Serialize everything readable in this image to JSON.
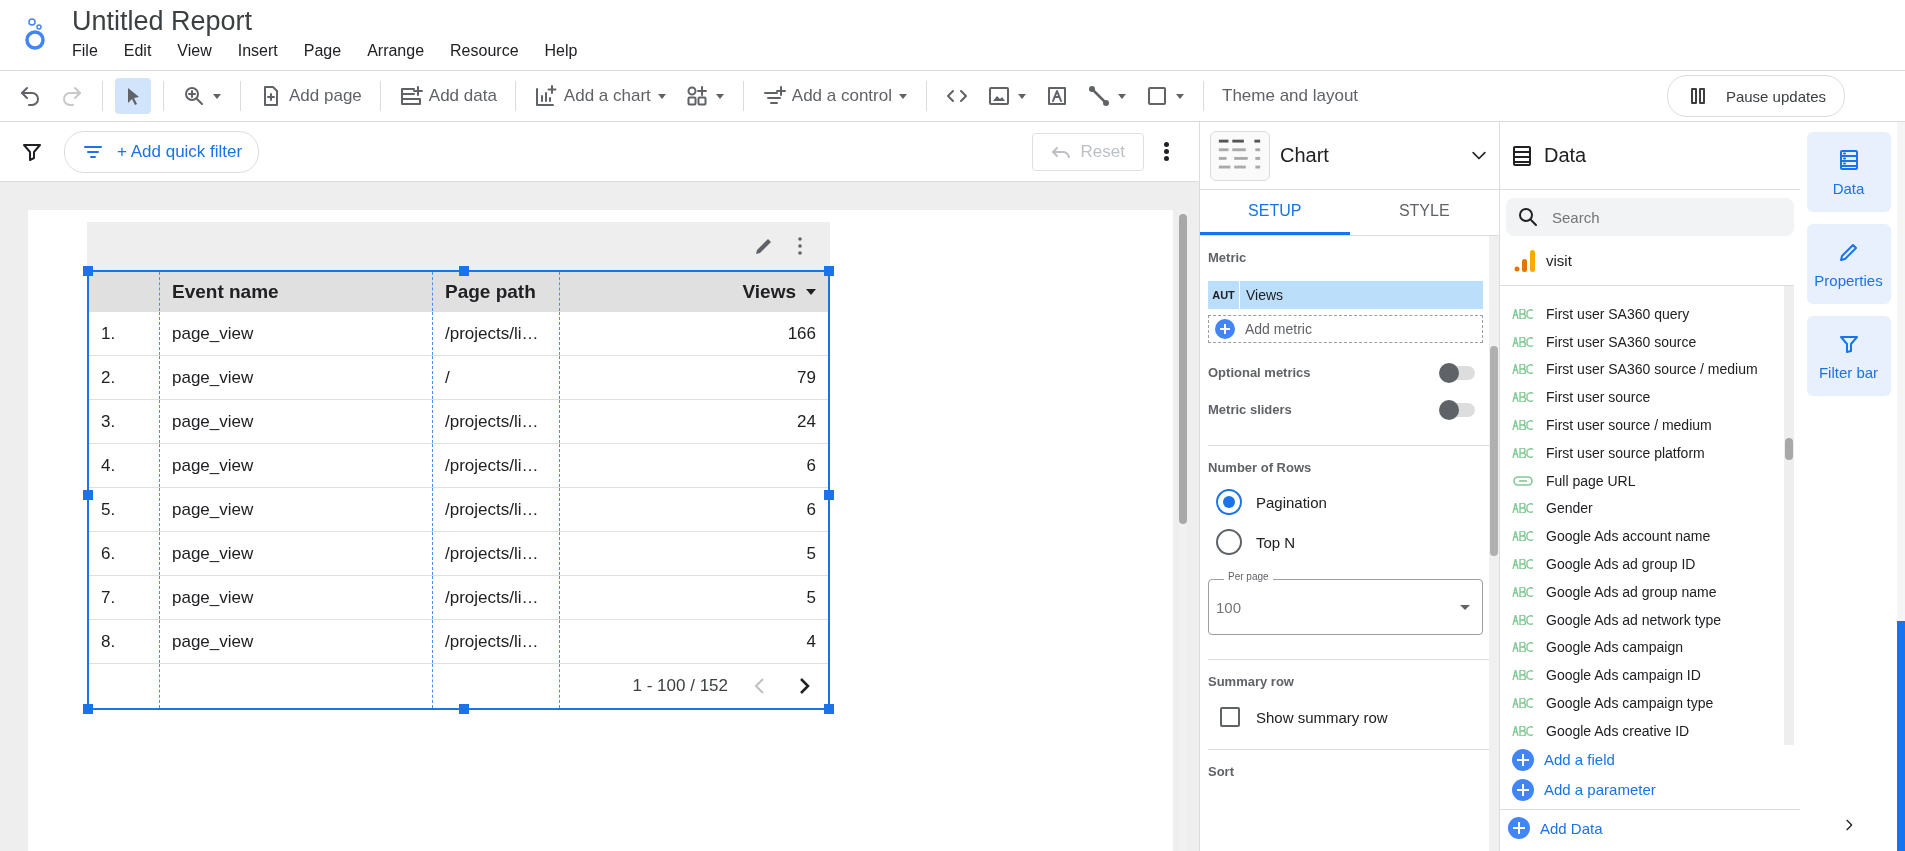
{
  "app": {
    "title": "Untitled Report",
    "menu": [
      "File",
      "Edit",
      "View",
      "Insert",
      "Page",
      "Arrange",
      "Resource",
      "Help"
    ]
  },
  "toolbar": {
    "undo": {
      "disabled": false
    },
    "redo": {
      "disabled": true
    },
    "select": {
      "selected": true
    },
    "add_page": "Add page",
    "add_data": "Add data",
    "add_chart": "Add a chart",
    "add_control": "Add a control",
    "theme": "Theme and layout",
    "pause_updates": "Pause updates"
  },
  "filter_bar": {
    "add_filter": "+ Add quick filter",
    "reset": {
      "label": "Reset",
      "disabled": true
    }
  },
  "table": {
    "columns": [
      "Event name",
      "Page path",
      "Views"
    ],
    "rows": [
      {
        "index": "1.",
        "event_name": "page_view",
        "page_path": "/projects/li…",
        "views": "166"
      },
      {
        "index": "2.",
        "event_name": "page_view",
        "page_path": "/",
        "views": "79"
      },
      {
        "index": "3.",
        "event_name": "page_view",
        "page_path": "/projects/li…",
        "views": "24"
      },
      {
        "index": "4.",
        "event_name": "page_view",
        "page_path": "/projects/li…",
        "views": "6"
      },
      {
        "index": "5.",
        "event_name": "page_view",
        "page_path": "/projects/li…",
        "views": "6"
      },
      {
        "index": "6.",
        "event_name": "page_view",
        "page_path": "/projects/li…",
        "views": "5"
      },
      {
        "index": "7.",
        "event_name": "page_view",
        "page_path": "/projects/li…",
        "views": "5"
      },
      {
        "index": "8.",
        "event_name": "page_view",
        "page_path": "/projects/li…",
        "views": "4"
      }
    ],
    "pagination": "1 - 100 / 152",
    "prev_disabled": true
  },
  "chart_panel": {
    "title": "Chart",
    "tabs": [
      {
        "label": "SETUP",
        "selected": true
      },
      {
        "label": "STYLE",
        "selected": false
      }
    ],
    "metric_label": "Metric",
    "metrics": [
      {
        "agg": "AUT",
        "name": "Views"
      }
    ],
    "add_metric": "Add metric",
    "toggles": [
      {
        "label": "Optional metrics",
        "on": false
      },
      {
        "label": "Metric sliders",
        "on": false
      }
    ],
    "rows_label": "Number of Rows",
    "row_options": [
      {
        "label": "Pagination",
        "selected": true
      },
      {
        "label": "Top N",
        "selected": false
      }
    ],
    "per_page": {
      "label": "Per page",
      "value": "100"
    },
    "summary_label": "Summary row",
    "summary_checkbox": {
      "label": "Show summary row",
      "checked": false
    },
    "sort_label": "Sort"
  },
  "data_panel": {
    "title": "Data",
    "search_placeholder": "Search",
    "source": "visit",
    "fields": [
      {
        "kind": "text",
        "name": "First user SA360 query"
      },
      {
        "kind": "text",
        "name": "First user SA360 source"
      },
      {
        "kind": "text",
        "name": "First user SA360 source / medium"
      },
      {
        "kind": "text",
        "name": "First user source"
      },
      {
        "kind": "text",
        "name": "First user source / medium"
      },
      {
        "kind": "text",
        "name": "First user source platform"
      },
      {
        "kind": "url",
        "name": "Full page URL"
      },
      {
        "kind": "text",
        "name": "Gender"
      },
      {
        "kind": "text",
        "name": "Google Ads account name"
      },
      {
        "kind": "text",
        "name": "Google Ads ad group ID"
      },
      {
        "kind": "text",
        "name": "Google Ads ad group name"
      },
      {
        "kind": "text",
        "name": "Google Ads ad network type"
      },
      {
        "kind": "text",
        "name": "Google Ads campaign"
      },
      {
        "kind": "text",
        "name": "Google Ads campaign ID"
      },
      {
        "kind": "text",
        "name": "Google Ads campaign type"
      },
      {
        "kind": "text",
        "name": "Google Ads creative ID"
      }
    ],
    "add_field": "Add a field",
    "add_parameter": "Add a parameter",
    "add_data": "Add Data"
  },
  "rail": [
    {
      "label": "Data",
      "kind": "data"
    },
    {
      "label": "Properties",
      "kind": "properties"
    },
    {
      "label": "Filter bar",
      "kind": "filter"
    }
  ]
}
